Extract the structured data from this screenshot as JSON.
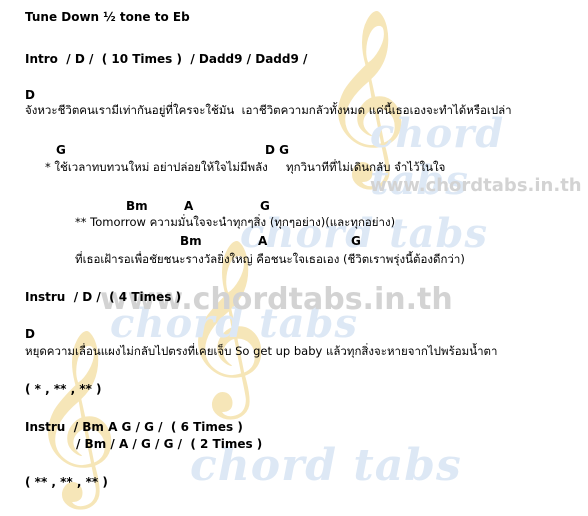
{
  "tuning": "Tune Down ½ tone to Eb",
  "intro": "Intro  / D /  ( 10 Times )  / Dadd9 / Dadd9 /",
  "verse": {
    "chord": "D",
    "lyric": "จังหวะชีวิตคนเรามีเท่ากันอยู่ที่ใครจะใช้มัน  เอาชีวิตความกลัวทั้งหมด แค่นี้เธอเองจะทำได้หรือเปล่า"
  },
  "pre_chorus": {
    "chord_g": "G",
    "chord_dg": "D G",
    "lyric": "* ใช้เวลาทบทวนใหม่ อย่าปล่อยให้ใจไม่มีพลัง     ทุกวินาทีที่ไม่เดินกลับ จำไว้ในใจ"
  },
  "chorus": {
    "chords_1": [
      "Bm",
      "A",
      "G"
    ],
    "lyric_1": "** Tomorrow ความมั่นใจจะนำทุกๆสิ่ง (ทุกๆอย่าง)(และทุกอย่าง)",
    "chords_2": [
      "Bm",
      "A",
      "G"
    ],
    "lyric_2": "ที่เธอเฝ้ารอเพื่อชัยชนะรางวัลยิ่งใหญ่ คือชนะใจเธอเอง (ชีวิตเราพรุ่งนี้ต้องดีกว่า)"
  },
  "instru_1": "Instru  / D /  ( 4 Times )",
  "bridge": {
    "chord": "D",
    "lyric": "หยุดความเลื่อนแผงไม่กลับไปตรงที่เคยเจ็บ So get up baby แล้วทุกสิ่งจะหายจากไปพร้อมน้ำตา"
  },
  "repeat_1": "( * , ** , ** )",
  "instru_2": {
    "line_1": "Instru  / Bm A G / G /  ( 6 Times )",
    "line_2": "/ Bm / A / G / G /  ( 2 Times )"
  },
  "repeat_2": "( ** , ** , ** )",
  "watermark": {
    "url": "www.chordtabs.in.th",
    "word": "chord tabs",
    "clef_icon": "treble-clef-icon",
    "colors": {
      "clef": "#f6e6b8",
      "word": "#dde8f5",
      "url": "#d3d3d3"
    }
  }
}
